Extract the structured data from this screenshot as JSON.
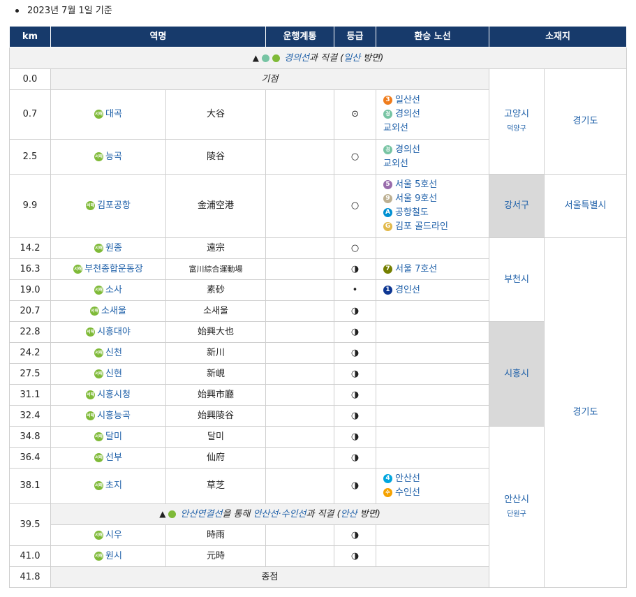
{
  "note": "2023년 7월 1일 기준",
  "headers": [
    "km",
    "역명",
    "운행계통",
    "등급",
    "환승 노선",
    "소재지"
  ],
  "top_direction": {
    "line": "경의선",
    "text1": "과 직결 (",
    "dest": "일산",
    "text2": " 방면)"
  },
  "start_label": "기점",
  "end_label": "종점",
  "mid_direction": {
    "line": "안산연결선",
    "text1": "을 통해 ",
    "lines": "안산선·수인선",
    "text2": "과 직결 (",
    "dest": "안산",
    "text3": " 방면)"
  },
  "icon_text": "서해",
  "rows": [
    {
      "km": "0.0"
    },
    {
      "km": "0.7",
      "name": "대곡",
      "hanja": "大谷",
      "grade": "⊙",
      "transfers": [
        {
          "badge": "3",
          "color": "#ef7c1c",
          "label": "일산선"
        },
        {
          "badge": "경",
          "color": "#77c4a3",
          "label": "경의선"
        },
        {
          "badge": "",
          "color": "",
          "label": "교외선"
        }
      ]
    },
    {
      "km": "2.5",
      "name": "능곡",
      "hanja": "陵谷",
      "grade": "○",
      "transfers": [
        {
          "badge": "경",
          "color": "#77c4a3",
          "label": "경의선"
        },
        {
          "badge": "",
          "color": "",
          "label": "교외선"
        }
      ]
    },
    {
      "km": "9.9",
      "name": "김포공항",
      "hanja": "金浦空港",
      "grade": "○",
      "transfers": [
        {
          "badge": "5",
          "color": "#996cac",
          "label": "서울 5호선"
        },
        {
          "badge": "9",
          "color": "#bdb092",
          "label": "서울 9호선"
        },
        {
          "badge": "A",
          "color": "#0090d2",
          "label": "공항철도"
        },
        {
          "badge": "G",
          "color": "#e2b94a",
          "label": "김포 골드라인"
        }
      ]
    },
    {
      "km": "14.2",
      "name": "원종",
      "hanja": "遠宗",
      "grade": "○",
      "transfers": []
    },
    {
      "km": "16.3",
      "name": "부천종합운동장",
      "hanja": "富川綜合運動場",
      "grade": "◑",
      "transfers": [
        {
          "badge": "7",
          "color": "#747f00",
          "label": "서울 7호선"
        }
      ]
    },
    {
      "km": "19.0",
      "name": "소사",
      "hanja": "素砂",
      "grade": "•",
      "transfers": [
        {
          "badge": "1",
          "color": "#0d3692",
          "label": "경인선"
        }
      ]
    },
    {
      "km": "20.7",
      "name": "소새울",
      "hanja": "소새울",
      "grade": "◑",
      "transfers": []
    },
    {
      "km": "22.8",
      "name": "시흥대야",
      "hanja": "始興大也",
      "grade": "◑",
      "transfers": []
    },
    {
      "km": "24.2",
      "name": "신천",
      "hanja": "新川",
      "grade": "◑",
      "transfers": []
    },
    {
      "km": "27.5",
      "name": "신현",
      "hanja": "新峴",
      "grade": "◑",
      "transfers": []
    },
    {
      "km": "31.1",
      "name": "시흥시청",
      "hanja": "始興市廳",
      "grade": "◑",
      "transfers": []
    },
    {
      "km": "32.4",
      "name": "시흥능곡",
      "hanja": "始興陵谷",
      "grade": "◑",
      "transfers": []
    },
    {
      "km": "34.8",
      "name": "달미",
      "hanja": "달미",
      "grade": "◑",
      "transfers": []
    },
    {
      "km": "36.4",
      "name": "선부",
      "hanja": "仙府",
      "grade": "◑",
      "transfers": []
    },
    {
      "km": "38.1",
      "name": "초지",
      "hanja": "草芝",
      "grade": "◑",
      "transfers": [
        {
          "badge": "4",
          "color": "#00a5de",
          "label": "안산선"
        },
        {
          "badge": "수",
          "color": "#f5a200",
          "label": "수인선"
        }
      ]
    },
    {
      "km": "39.5",
      "name": "시우",
      "hanja": "時雨",
      "grade": "◑",
      "transfers": []
    },
    {
      "km": "41.0",
      "name": "원시",
      "hanja": "元時",
      "grade": "◑",
      "transfers": []
    },
    {
      "km": "41.8"
    }
  ],
  "locations": {
    "goyang": {
      "city": "고양시",
      "district": "덕양구",
      "province": "경기도"
    },
    "gangseo": {
      "city": "강서구",
      "province": "서울특별시"
    },
    "bucheon": {
      "city": "부천시"
    },
    "siheung": {
      "city": "시흥시"
    },
    "gyeonggi": {
      "province": "경기도"
    },
    "ansan": {
      "city": "안산시",
      "district": "단원구"
    }
  }
}
